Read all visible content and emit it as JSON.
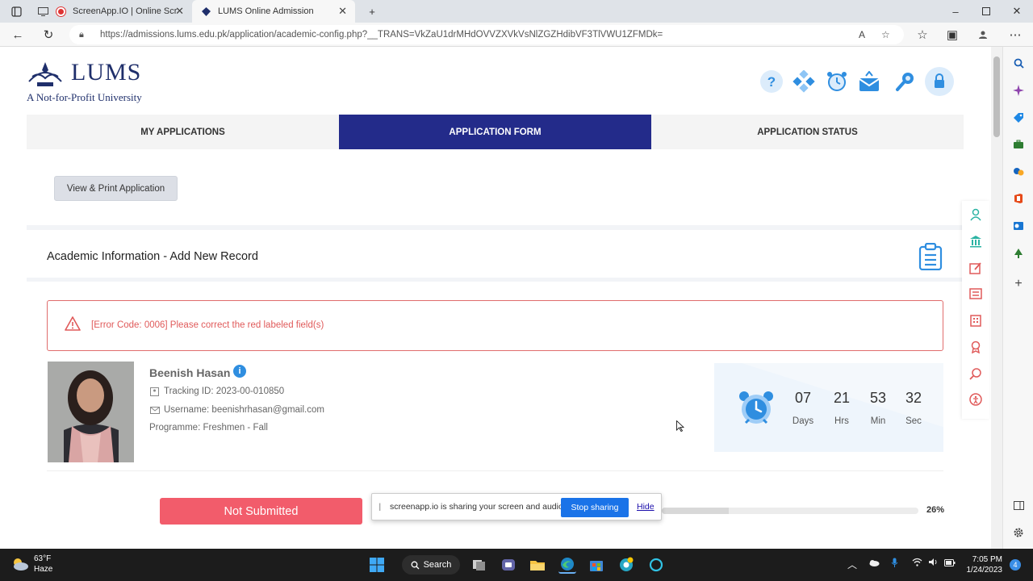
{
  "browser": {
    "tabs": [
      {
        "title": "ScreenApp.IO | Online Scree",
        "recording": true
      },
      {
        "title": "LUMS Online Admission",
        "active": true
      }
    ],
    "url": "https://admissions.lums.edu.pk/application/academic-config.php?__TRANS=VkZaU1drMHdOVVZXVkVsNlZGZHdibVF3TlVWU1ZFMDk="
  },
  "header": {
    "logo_name": "LUMS",
    "logo_tagline": "A Not-for-Profit University"
  },
  "nav": {
    "tabs": [
      "MY APPLICATIONS",
      "APPLICATION FORM",
      "APPLICATION STATUS"
    ],
    "active_index": 1
  },
  "actions": {
    "print_label": "View & Print Application"
  },
  "section": {
    "title": "Academic Information - Add New Record"
  },
  "error": {
    "message": "[Error Code: 0006] Please correct the red labeled field(s)"
  },
  "applicant": {
    "name": "Beenish Hasan",
    "tracking": "Tracking ID: 2023-00-010850",
    "username": "Username: beenishrhasan@gmail.com",
    "programme": "Programme: Freshmen - Fall"
  },
  "countdown": {
    "days": "07",
    "hrs": "21",
    "min": "53",
    "sec": "32",
    "days_label": "Days",
    "hrs_label": "Hrs",
    "min_label": "Min",
    "sec_label": "Sec"
  },
  "status": {
    "label": "Not Submitted",
    "progress_pct": 26,
    "progress_text": "26%"
  },
  "share_bar": {
    "message": "screenapp.io is sharing your screen and audio.",
    "stop_label": "Stop sharing",
    "hide_label": "Hide"
  },
  "taskbar": {
    "temp": "63°F",
    "condition": "Haze",
    "search_label": "Search",
    "time": "7:05 PM",
    "date": "1/24/2023",
    "notifications": "4"
  },
  "colors": {
    "brand_navy": "#232b8a",
    "accent_blue": "#2f8ee0",
    "error_red": "#e05a5a",
    "status_red": "#f25c6b",
    "rail_teal": "#2bb3a3"
  }
}
